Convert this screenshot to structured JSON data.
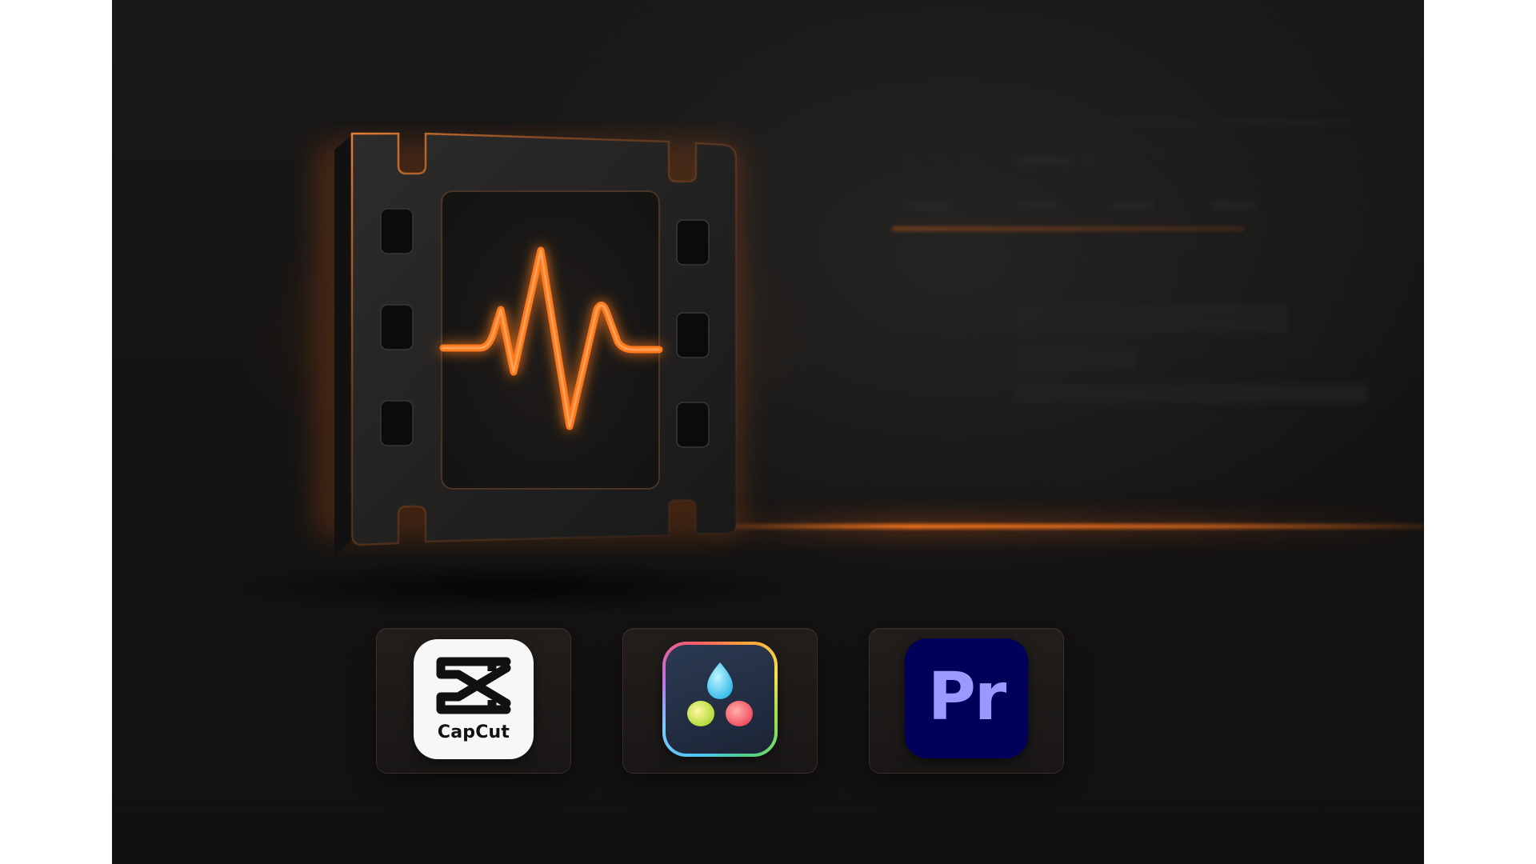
{
  "hero": {
    "icon": "film-strip-waveform-icon",
    "accent_color": "#ff7a1a"
  },
  "apps": [
    {
      "name": "capcut",
      "label": "CapCut",
      "icon": "capcut-logo"
    },
    {
      "name": "davinci-resolve",
      "icon": "davinci-resolve-logo"
    },
    {
      "name": "premiere-pro",
      "label": "Pr",
      "icon": "premiere-pro-logo",
      "color": "#9999ff",
      "background": "#00005b"
    }
  ]
}
